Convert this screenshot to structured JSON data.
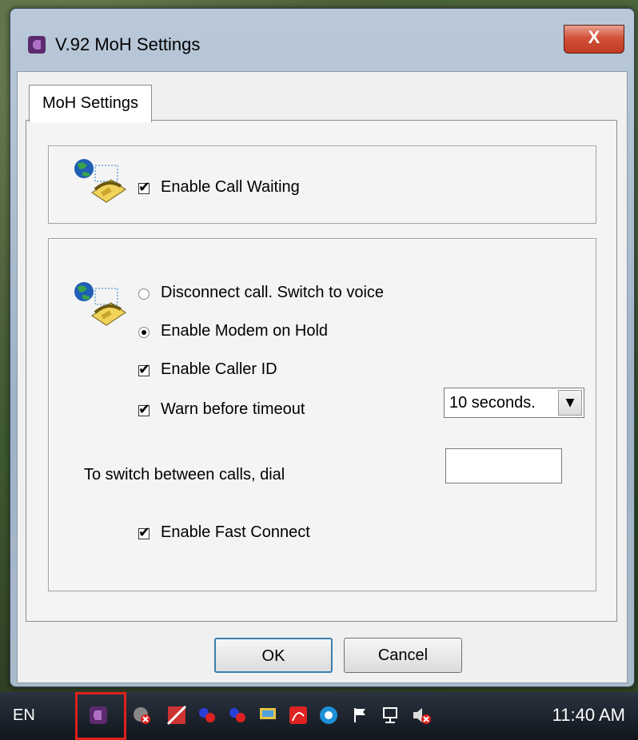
{
  "window": {
    "title": "V.92 MoH Settings",
    "close_label": "X",
    "tab": "MoH Settings"
  },
  "call_waiting": {
    "label": "Enable Call Waiting",
    "checked": true
  },
  "options": {
    "radio_disconnect": {
      "label": "Disconnect call. Switch to voice",
      "selected": false
    },
    "radio_modem_hold": {
      "label": "Enable Modem on Hold",
      "selected": true
    },
    "caller_id": {
      "label": "Enable Caller ID",
      "checked": true
    },
    "warn_timeout": {
      "label": "Warn before timeout",
      "checked": true
    },
    "timeout_select": {
      "value": "10 seconds."
    },
    "switch_calls_label": "To switch between calls, dial",
    "switch_calls_value": "",
    "fast_connect": {
      "label": "Enable Fast Connect",
      "checked": true
    }
  },
  "buttons": {
    "ok": "OK",
    "cancel": "Cancel"
  },
  "taskbar": {
    "language": "EN",
    "clock": "11:40 AM"
  },
  "colors": {
    "accent_red": "#e2201b",
    "window_bg": "#f0f0f0"
  }
}
